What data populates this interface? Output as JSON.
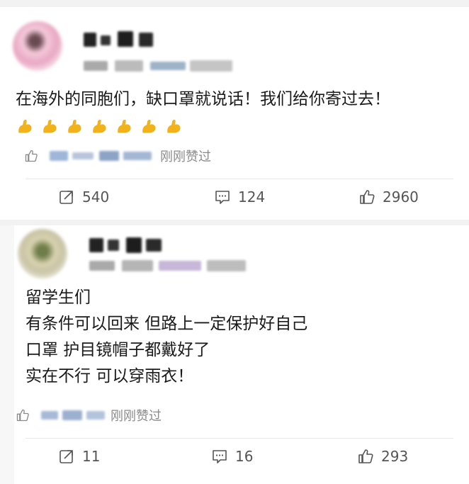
{
  "posts": [
    {
      "content_lines": [
        "在海外的同胞们，缺口罩就说话！我们给你寄过去！"
      ],
      "emoji_icon": "flexed-biceps-icon",
      "emoji_count": 7,
      "liked_text": "刚刚赞过",
      "actions": {
        "share": "540",
        "comment": "124",
        "like": "2960"
      }
    },
    {
      "content_lines": [
        "留学生们",
        "有条件可以回来 但路上一定保护好自己",
        "口罩 护目镜帽子都戴好了",
        "实在不行 可以穿雨衣！"
      ],
      "liked_text": "刚刚赞过",
      "actions": {
        "share": "11",
        "comment": "16",
        "like": "293"
      }
    }
  ],
  "colors": {
    "muted": "#8a8a8a",
    "text": "#1a1a1a",
    "emoji": "#f2b21c"
  }
}
